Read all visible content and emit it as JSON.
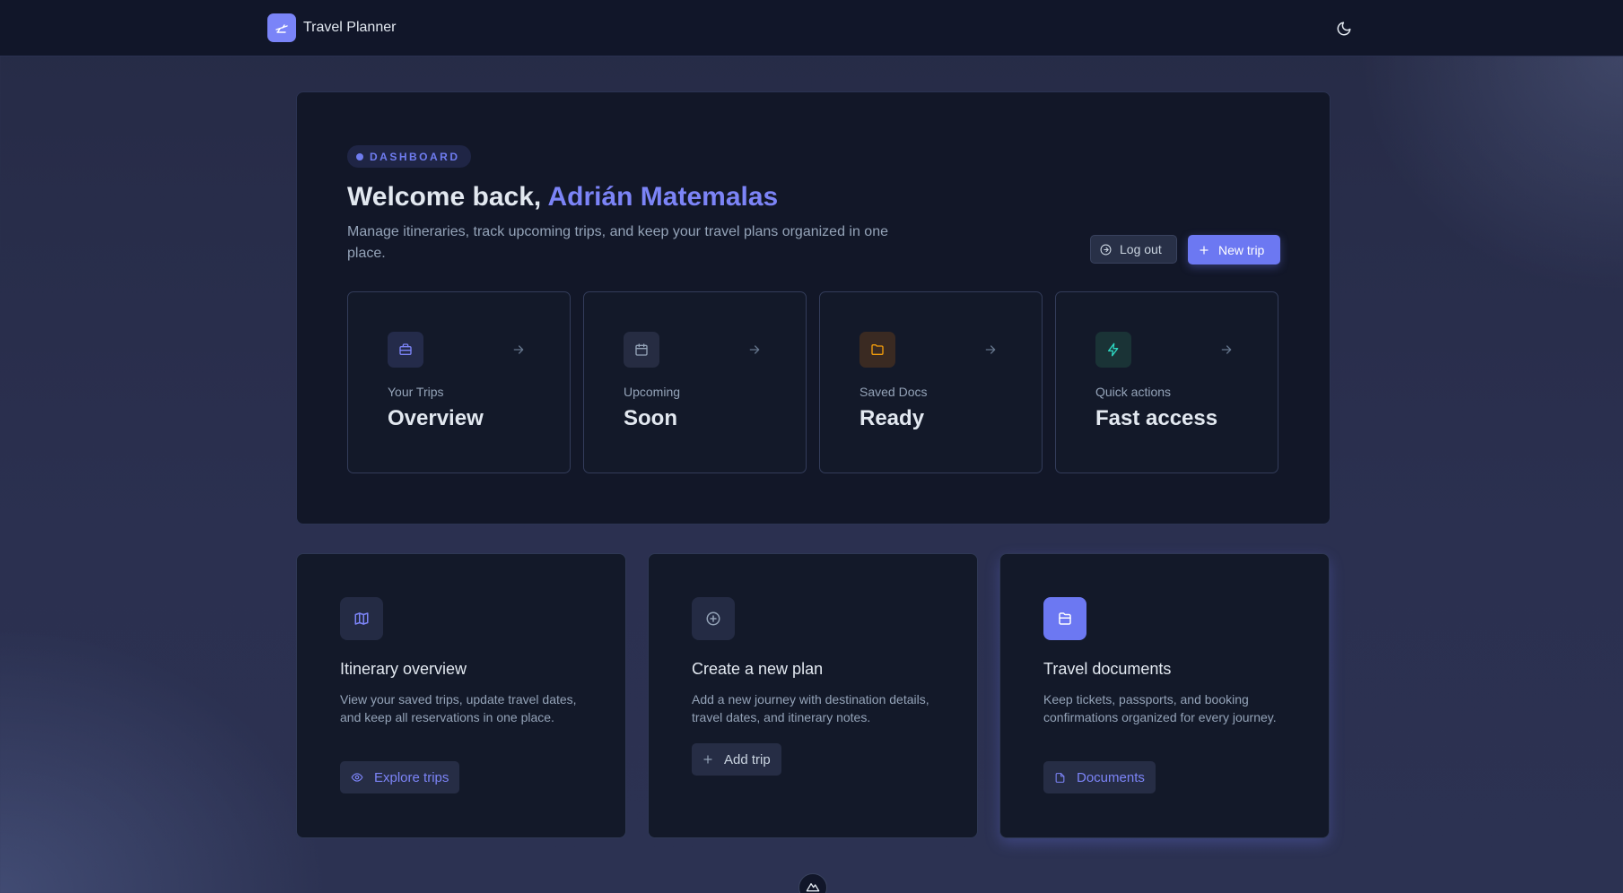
{
  "app": {
    "title": "Travel Planner",
    "logo_icon": "plane-icon",
    "theme_toggle_icon": "moon-icon"
  },
  "hero": {
    "badge": "DASHBOARD",
    "welcome_prefix": "Welcome back,",
    "user_name": "Adrián Matemalas",
    "subtitle": "Manage itineraries, track upcoming trips, and keep your travel plans organized in one place.",
    "logout_label": "Log out",
    "new_trip_label": "New trip",
    "stats": [
      {
        "label": "Your Trips",
        "value": "Overview",
        "icon": "briefcase-icon",
        "icon_color": "#7c84f7"
      },
      {
        "label": "Upcoming",
        "value": "Soon",
        "icon": "calendar-icon",
        "icon_color": "#94a3b8"
      },
      {
        "label": "Saved Docs",
        "value": "Ready",
        "icon": "folder-icon",
        "icon_color": "#f59e0b"
      },
      {
        "label": "Quick actions",
        "value": "Fast access",
        "icon": "lightning-icon",
        "icon_color": "#2dd4bf"
      }
    ]
  },
  "cards": [
    {
      "title": "Itinerary overview",
      "description": "View your saved trips, update travel dates, and keep all reservations in one place.",
      "button_label": "Explore trips",
      "icon": "map-icon",
      "button_icon": "eye-icon"
    },
    {
      "title": "Create a new plan",
      "description": "Add a new journey with destination details, travel dates, and itinerary notes.",
      "button_label": "Add trip",
      "icon": "plus-circle-icon",
      "button_icon": "plus-icon"
    },
    {
      "title": "Travel documents",
      "description": "Keep tickets, passports, and booking confirmations organized for every journey.",
      "button_label": "Documents",
      "icon": "document-folder-icon",
      "button_icon": "file-icon"
    }
  ],
  "colors": {
    "accent": "#6c78f2",
    "background": "#262b46",
    "panel": "#121728"
  }
}
